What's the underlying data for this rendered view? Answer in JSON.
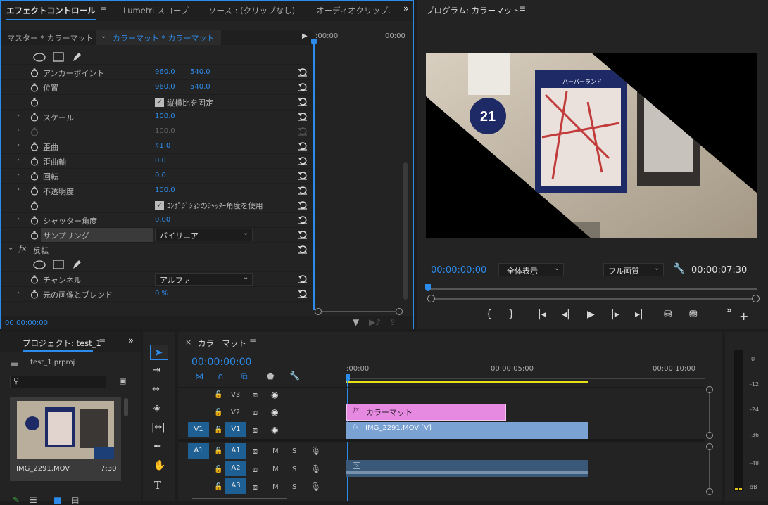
{
  "effect_controls": {
    "tabs": [
      "エフェクトコントロール",
      "Lumetri スコープ",
      "ソース : (クリップなし)",
      "オーディオクリップ."
    ],
    "master_label": "マスター * カラーマット",
    "clip_label": "カラーマット * カラーマット",
    "time_start": ":00:00",
    "time_end": "00:00",
    "rows": {
      "anchor": {
        "label": "アンカーポイント",
        "x": "960.0",
        "y": "540.0"
      },
      "position": {
        "label": "位置",
        "x": "960.0",
        "y": "540.0"
      },
      "uniform": {
        "label": "縦横比を固定"
      },
      "scale": {
        "label": "スケール",
        "value": "100.0"
      },
      "scale_width": {
        "value": "100.0"
      },
      "skew": {
        "label": "歪曲",
        "value": "41.0"
      },
      "skew_axis": {
        "label": "歪曲軸",
        "value": "0.0"
      },
      "rotation": {
        "label": "回転",
        "value": "0.0"
      },
      "opacity": {
        "label": "不透明度",
        "value": "100.0"
      },
      "shutter_use": {
        "label": "ｺﾝﾎﾟｼﾞｼｮﾝのｼｬｯﾀｰ角度を使用"
      },
      "shutter_angle": {
        "label": "シャッター角度",
        "value": "0.00"
      },
      "sampling": {
        "label": "サンプリング",
        "value": "バイリニア"
      },
      "invert": {
        "label": "反転"
      },
      "channel": {
        "label": "チャンネル",
        "value": "アルファ"
      },
      "blend": {
        "label": "元の画像とブレンド",
        "value": "0 %"
      }
    },
    "footer_time": "00:00:00:00"
  },
  "program": {
    "title": "プログラム: カラーマット",
    "timecode": "00:00:00:00",
    "fit": "全体表示",
    "quality": "フル画質",
    "duration": "00:00:07:30",
    "sign_number": "21",
    "sign_label": "ハーバーランド"
  },
  "project": {
    "title": "プロジェクト: test_1",
    "file": "test_1.prproj",
    "clip_name": "IMG_2291.MOV",
    "clip_duration": "7:30"
  },
  "timeline": {
    "title": "カラーマット",
    "timecode": "00:00:00:00",
    "ruler": [
      ":00:00",
      "00:00:05:00",
      "00:00:10:00"
    ],
    "tracks": {
      "v3": "V3",
      "v2": "V2",
      "v1": "V1",
      "v1src": "V1",
      "a1": "A1",
      "a1src": "A1",
      "a2": "A2",
      "a3": "A3",
      "m": "M",
      "s": "S"
    },
    "clips": {
      "matte": "カラーマット",
      "video": "IMG_2291.MOV [V]"
    }
  },
  "meter": {
    "scale": [
      "0",
      "-12",
      "-24",
      "-36",
      "-48",
      "dB"
    ]
  },
  "colors": {
    "accent": "#2d8ceb",
    "matte_clip": "#e58ae0",
    "video_clip": "#7aa3d4",
    "audio_clip": "#3a5878",
    "track_target": "#1e5f94",
    "work_area": "#e5e01a"
  }
}
